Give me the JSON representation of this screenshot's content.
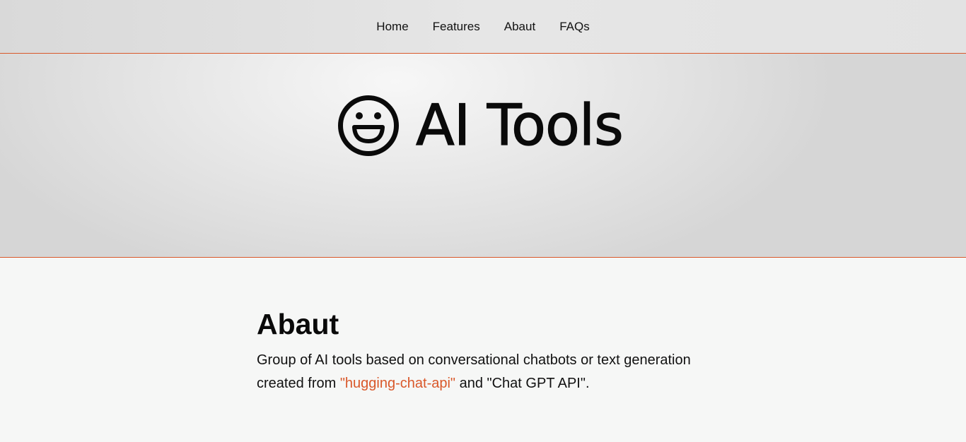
{
  "nav": {
    "items": [
      {
        "label": "Home"
      },
      {
        "label": "Features"
      },
      {
        "label": "Abaut"
      },
      {
        "label": "FAQs"
      }
    ]
  },
  "hero": {
    "icon": "smiley-face-icon",
    "title": "AI Tools"
  },
  "about": {
    "heading": "Abaut",
    "text_before": "Group of AI tools based on conversational chatbots or text generation created from ",
    "link_text": "\"hugging-chat-api\"",
    "text_after": " and \"Chat GPT API\"."
  },
  "colors": {
    "accent": "#d9582a",
    "page_background": "#f6f7f6"
  }
}
